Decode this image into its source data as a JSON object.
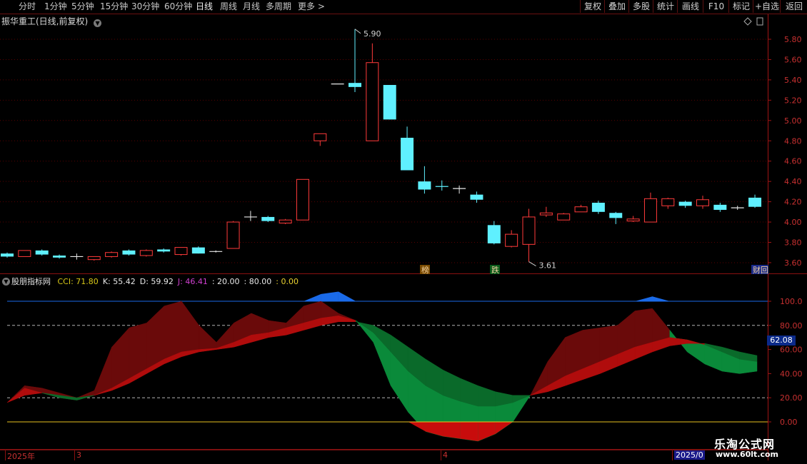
{
  "toolbar": {
    "periods": [
      "分时",
      "1分钟",
      "5分钟",
      "15分钟",
      "30分钟",
      "60分钟",
      "日线",
      "周线",
      "月线",
      "多周期",
      "更多 >"
    ],
    "active_period": "日线",
    "right_buttons": [
      "复权",
      "叠加",
      "多股",
      "统计",
      "画线",
      "F10",
      "标记",
      "+自选",
      "返回"
    ]
  },
  "main_chart": {
    "title": "振华重工(日线,前复权)",
    "price_ticks": [
      "5.80",
      "5.60",
      "5.40",
      "5.20",
      "5.00",
      "4.80",
      "4.60",
      "4.40",
      "4.20",
      "4.00",
      "3.80",
      "3.60"
    ],
    "high_label": "5.90",
    "low_label": "3.61",
    "markers": [
      "榜",
      "跌",
      "财|回"
    ],
    "candles": [
      {
        "o": 3.66,
        "c": 3.69,
        "h": 3.7,
        "l": 3.65,
        "d": "down"
      },
      {
        "o": 3.66,
        "c": 3.72,
        "h": 3.72,
        "l": 3.66,
        "d": "up"
      },
      {
        "o": 3.72,
        "c": 3.68,
        "h": 3.73,
        "l": 3.67,
        "d": "down"
      },
      {
        "o": 3.67,
        "c": 3.65,
        "h": 3.68,
        "l": 3.64,
        "d": "down"
      },
      {
        "o": 3.66,
        "c": 3.66,
        "h": 3.69,
        "l": 3.63,
        "d": "flat"
      },
      {
        "o": 3.63,
        "c": 3.66,
        "h": 3.66,
        "l": 3.62,
        "d": "up"
      },
      {
        "o": 3.66,
        "c": 3.7,
        "h": 3.71,
        "l": 3.65,
        "d": "up"
      },
      {
        "o": 3.72,
        "c": 3.68,
        "h": 3.73,
        "l": 3.67,
        "d": "down"
      },
      {
        "o": 3.67,
        "c": 3.72,
        "h": 3.73,
        "l": 3.66,
        "d": "up"
      },
      {
        "o": 3.73,
        "c": 3.71,
        "h": 3.74,
        "l": 3.7,
        "d": "down"
      },
      {
        "o": 3.68,
        "c": 3.75,
        "h": 3.75,
        "l": 3.67,
        "d": "up"
      },
      {
        "o": 3.75,
        "c": 3.69,
        "h": 3.76,
        "l": 3.69,
        "d": "down"
      },
      {
        "o": 3.71,
        "c": 3.71,
        "h": 3.72,
        "l": 3.7,
        "d": "flat"
      },
      {
        "o": 3.74,
        "c": 4.0,
        "h": 4.01,
        "l": 3.74,
        "d": "up"
      },
      {
        "o": 4.05,
        "c": 4.05,
        "h": 4.11,
        "l": 4.01,
        "d": "flat"
      },
      {
        "o": 4.05,
        "c": 4.01,
        "h": 4.06,
        "l": 4.0,
        "d": "down"
      },
      {
        "o": 3.99,
        "c": 4.02,
        "h": 4.03,
        "l": 3.98,
        "d": "up"
      },
      {
        "o": 4.02,
        "c": 4.42,
        "h": 4.42,
        "l": 4.02,
        "d": "up"
      },
      {
        "o": 4.8,
        "c": 4.87,
        "h": 4.87,
        "l": 4.75,
        "d": "up"
      },
      {
        "o": 5.36,
        "c": 5.36,
        "h": 5.36,
        "l": 5.36,
        "d": "flat"
      },
      {
        "o": 5.37,
        "c": 5.33,
        "h": 5.9,
        "l": 5.28,
        "d": "down"
      },
      {
        "o": 4.8,
        "c": 5.57,
        "h": 5.76,
        "l": 4.8,
        "d": "up"
      },
      {
        "o": 5.35,
        "c": 5.01,
        "h": 5.35,
        "l": 5.01,
        "d": "down"
      },
      {
        "o": 4.83,
        "c": 4.51,
        "h": 4.94,
        "l": 4.51,
        "d": "down"
      },
      {
        "o": 4.4,
        "c": 4.32,
        "h": 4.55,
        "l": 4.28,
        "d": "down"
      },
      {
        "o": 4.35,
        "c": 4.34,
        "h": 4.41,
        "l": 4.31,
        "d": "down"
      },
      {
        "o": 4.33,
        "c": 4.33,
        "h": 4.36,
        "l": 4.28,
        "d": "flat"
      },
      {
        "o": 4.27,
        "c": 4.22,
        "h": 4.3,
        "l": 4.19,
        "d": "down"
      },
      {
        "o": 3.97,
        "c": 3.79,
        "h": 4.01,
        "l": 3.78,
        "d": "down"
      },
      {
        "o": 3.76,
        "c": 3.88,
        "h": 3.92,
        "l": 3.75,
        "d": "up"
      },
      {
        "o": 3.78,
        "c": 4.05,
        "h": 4.13,
        "l": 3.61,
        "d": "up"
      },
      {
        "o": 4.07,
        "c": 4.09,
        "h": 4.15,
        "l": 4.05,
        "d": "up"
      },
      {
        "o": 4.02,
        "c": 4.08,
        "h": 4.09,
        "l": 4.02,
        "d": "up"
      },
      {
        "o": 4.1,
        "c": 4.15,
        "h": 4.17,
        "l": 4.1,
        "d": "up"
      },
      {
        "o": 4.19,
        "c": 4.1,
        "h": 4.21,
        "l": 4.08,
        "d": "down"
      },
      {
        "o": 4.09,
        "c": 4.04,
        "h": 4.1,
        "l": 3.98,
        "d": "down"
      },
      {
        "o": 4.01,
        "c": 4.03,
        "h": 4.06,
        "l": 4.0,
        "d": "up"
      },
      {
        "o": 4.0,
        "c": 4.23,
        "h": 4.29,
        "l": 4.0,
        "d": "up"
      },
      {
        "o": 4.16,
        "c": 4.23,
        "h": 4.24,
        "l": 4.13,
        "d": "up"
      },
      {
        "o": 4.2,
        "c": 4.16,
        "h": 4.21,
        "l": 4.14,
        "d": "down"
      },
      {
        "o": 4.16,
        "c": 4.22,
        "h": 4.26,
        "l": 4.13,
        "d": "up"
      },
      {
        "o": 4.17,
        "c": 4.12,
        "h": 4.19,
        "l": 4.1,
        "d": "down"
      },
      {
        "o": 4.14,
        "c": 4.14,
        "h": 4.16,
        "l": 4.12,
        "d": "flat"
      },
      {
        "o": 4.15,
        "c": 4.24,
        "h": 4.27,
        "l": 4.14,
        "d": "down"
      }
    ]
  },
  "indicator": {
    "name": "股朋指标网",
    "values_text": [
      {
        "label": "CCI: 71.80",
        "color": "#d8c818"
      },
      {
        "label": "K: 55.42",
        "color": "#e8e8e8"
      },
      {
        "label": "D: 59.92",
        "color": "#e8e8e8"
      },
      {
        "label": "J: 46.41",
        "color": "#d040d0"
      },
      {
        "label": ": 20.00",
        "color": "#e8e8e8"
      },
      {
        "label": ": 80.00",
        "color": "#e8e8e8"
      },
      {
        "label": ": 0.00",
        "color": "#e8d030"
      }
    ],
    "ticks": [
      "100.0",
      "80.00",
      "60.00",
      "40.00",
      "20.00",
      "0.00"
    ],
    "current_value": "62.08",
    "k": [
      16,
      28,
      24,
      20,
      18,
      22,
      28,
      36,
      44,
      52,
      58,
      60,
      61,
      66,
      72,
      74,
      78,
      82,
      86,
      88,
      84,
      74,
      58,
      42,
      30,
      22,
      17,
      13,
      13,
      16,
      22,
      30,
      38,
      44,
      50,
      56,
      62,
      66,
      70,
      68,
      64,
      58,
      52,
      50
    ],
    "d": [
      16,
      22,
      24,
      22,
      20,
      22,
      26,
      32,
      40,
      48,
      54,
      58,
      60,
      62,
      66,
      70,
      72,
      76,
      80,
      83,
      83,
      80,
      72,
      62,
      52,
      43,
      36,
      30,
      25,
      22,
      22,
      25,
      30,
      35,
      40,
      46,
      52,
      58,
      63,
      65,
      65,
      62,
      58,
      55
    ],
    "j": [
      16,
      30,
      28,
      24,
      20,
      26,
      62,
      78,
      82,
      96,
      100,
      80,
      66,
      82,
      90,
      84,
      82,
      96,
      100,
      90,
      84,
      66,
      30,
      8,
      -8,
      -12,
      -14,
      -16,
      -10,
      0,
      22,
      50,
      70,
      76,
      78,
      80,
      92,
      94,
      76,
      58,
      48,
      42,
      40,
      42
    ],
    "blue_over": [
      0,
      0,
      0,
      0,
      0,
      0,
      0,
      0,
      0,
      0,
      0,
      0,
      0,
      0,
      0,
      0,
      0,
      0,
      6,
      8,
      0,
      0,
      0,
      0,
      0,
      0,
      0,
      0,
      0,
      0,
      0,
      0,
      0,
      0,
      0,
      0,
      0,
      4,
      0,
      0,
      0,
      0,
      0,
      0
    ]
  },
  "date_axis": {
    "labels": [
      "2025年",
      "3",
      "4",
      "2025/0"
    ]
  },
  "watermark": {
    "name": "乐淘公式网",
    "url": "www.60lt.com"
  },
  "colors": {
    "up": "#ff3a3a",
    "down": "#5ff0ff",
    "axis": "#a01414",
    "green_dark": "#0a6a2a",
    "green_light": "#0a8a3a",
    "red_dark": "#6a0a0a",
    "red_light": "#b00c0c",
    "blue": "#1a6ae8"
  }
}
